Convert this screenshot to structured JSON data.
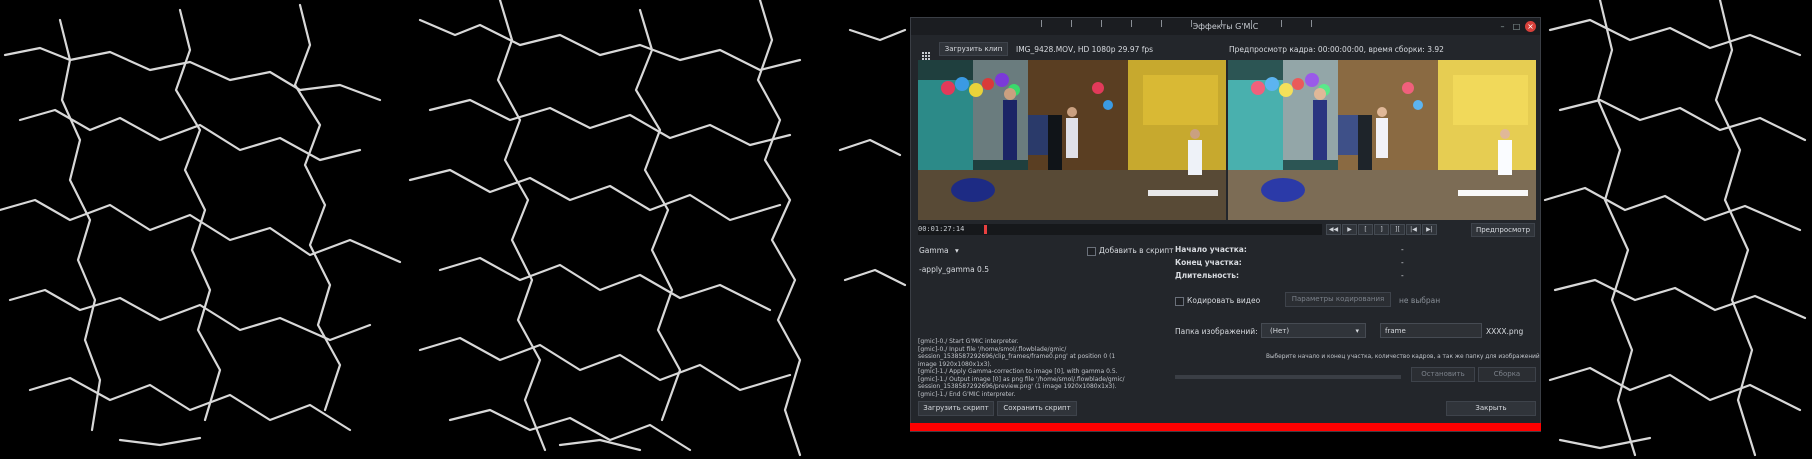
{
  "dialog": {
    "title": "Эффекты G'MIC",
    "load_clip_label": "Загрузить клип",
    "clip_info": "IMG_9428.MOV, HD 1080p 29.97 fps",
    "preview_info": "Предпросмотр кадра: 00:00:00:00, время сборки: 3.92",
    "timecode": "00:01:27:14",
    "preview_button_label": "Предпросмотр",
    "effect_name": "Gamma",
    "add_to_script_label": "Добавить в скрипт",
    "script_text": "-apply_gamma 0.5",
    "log_lines": [
      "[gmic]-0./ Start G'MIC interpreter.",
      "[gmic]-0./ Input file '/home/smol/.flowblade/gmic/",
      "session_1538587292696/clip_frames/frame0.png' at position 0 (1",
      "image 1920x1080x1x3).",
      "[gmic]-1./ Apply Gamma-correction to image [0], with gamma 0.5.",
      "[gmic]-1./ Output image [0] as png file '/home/smol/.flowblade/gmic/",
      "session_1538587292696/preview.png' (1 image 1920x1080x1x3).",
      "[gmic]-1./ End G'MIC interpreter."
    ],
    "load_script_label": "Загрузить скрипт",
    "save_script_label": "Сохранить скрипт",
    "range_start_label": "Начало участка:",
    "range_end_label": "Конец участка:",
    "duration_label": "Длительность:",
    "range_start_value": "-",
    "range_end_value": "-",
    "duration_value": "-",
    "encode_video_label": "Кодировать видео",
    "encode_params_label": "Параметры кодирования",
    "encode_not_selected": "не выбран",
    "frames_folder_label": "Папка изображений:",
    "frames_folder_value": "(Нет)",
    "frame_name_value": "frame",
    "frame_suffix": "XXXX.png",
    "hint_text": "Выберите начало и конец участка, количество кадров, а так же папку для изображений",
    "stop_label": "Остановить",
    "render_label": "Сборка",
    "close_label": "Закрыть"
  }
}
